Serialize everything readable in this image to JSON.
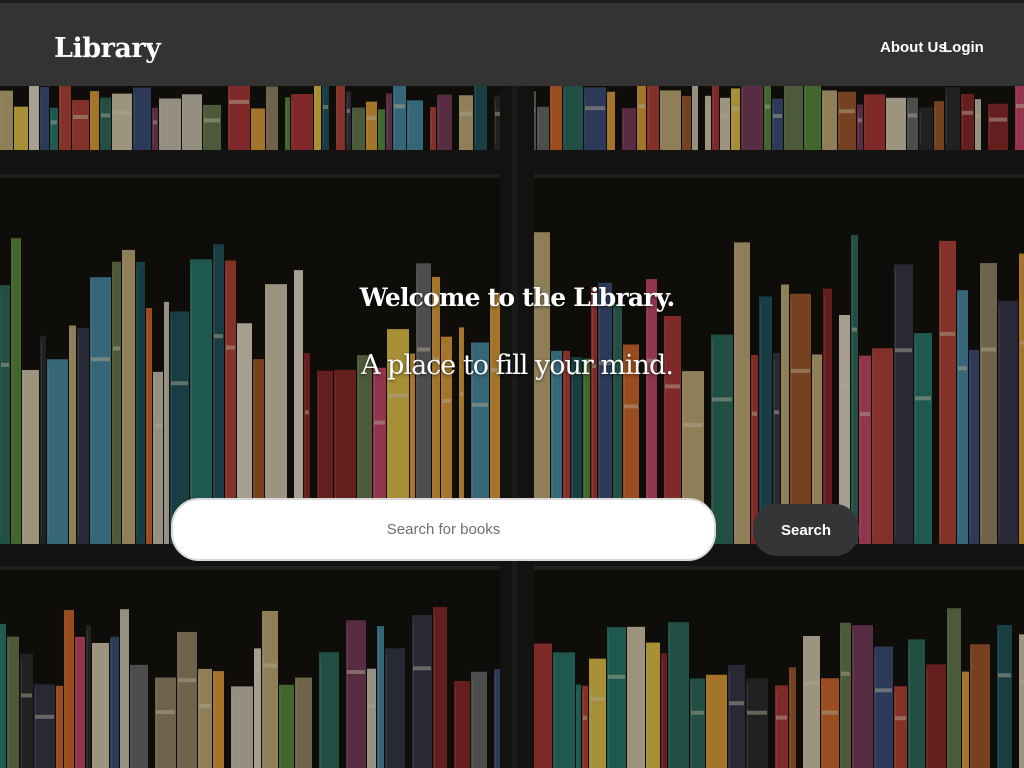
{
  "navbar": {
    "brand": "Library",
    "links": [
      {
        "label": "About Us"
      },
      {
        "label": "Login"
      }
    ]
  },
  "hero": {
    "title": "Welcome to the Library.",
    "subtitle": "A place to fill your mind."
  },
  "search": {
    "placeholder": "Search for books",
    "value": "",
    "button_label": "Search"
  },
  "colors": {
    "navbar_bg": "#333333",
    "button_bg": "#353535",
    "text": "#ffffff"
  },
  "icons": {
    "background": "bookshelf-photo"
  }
}
